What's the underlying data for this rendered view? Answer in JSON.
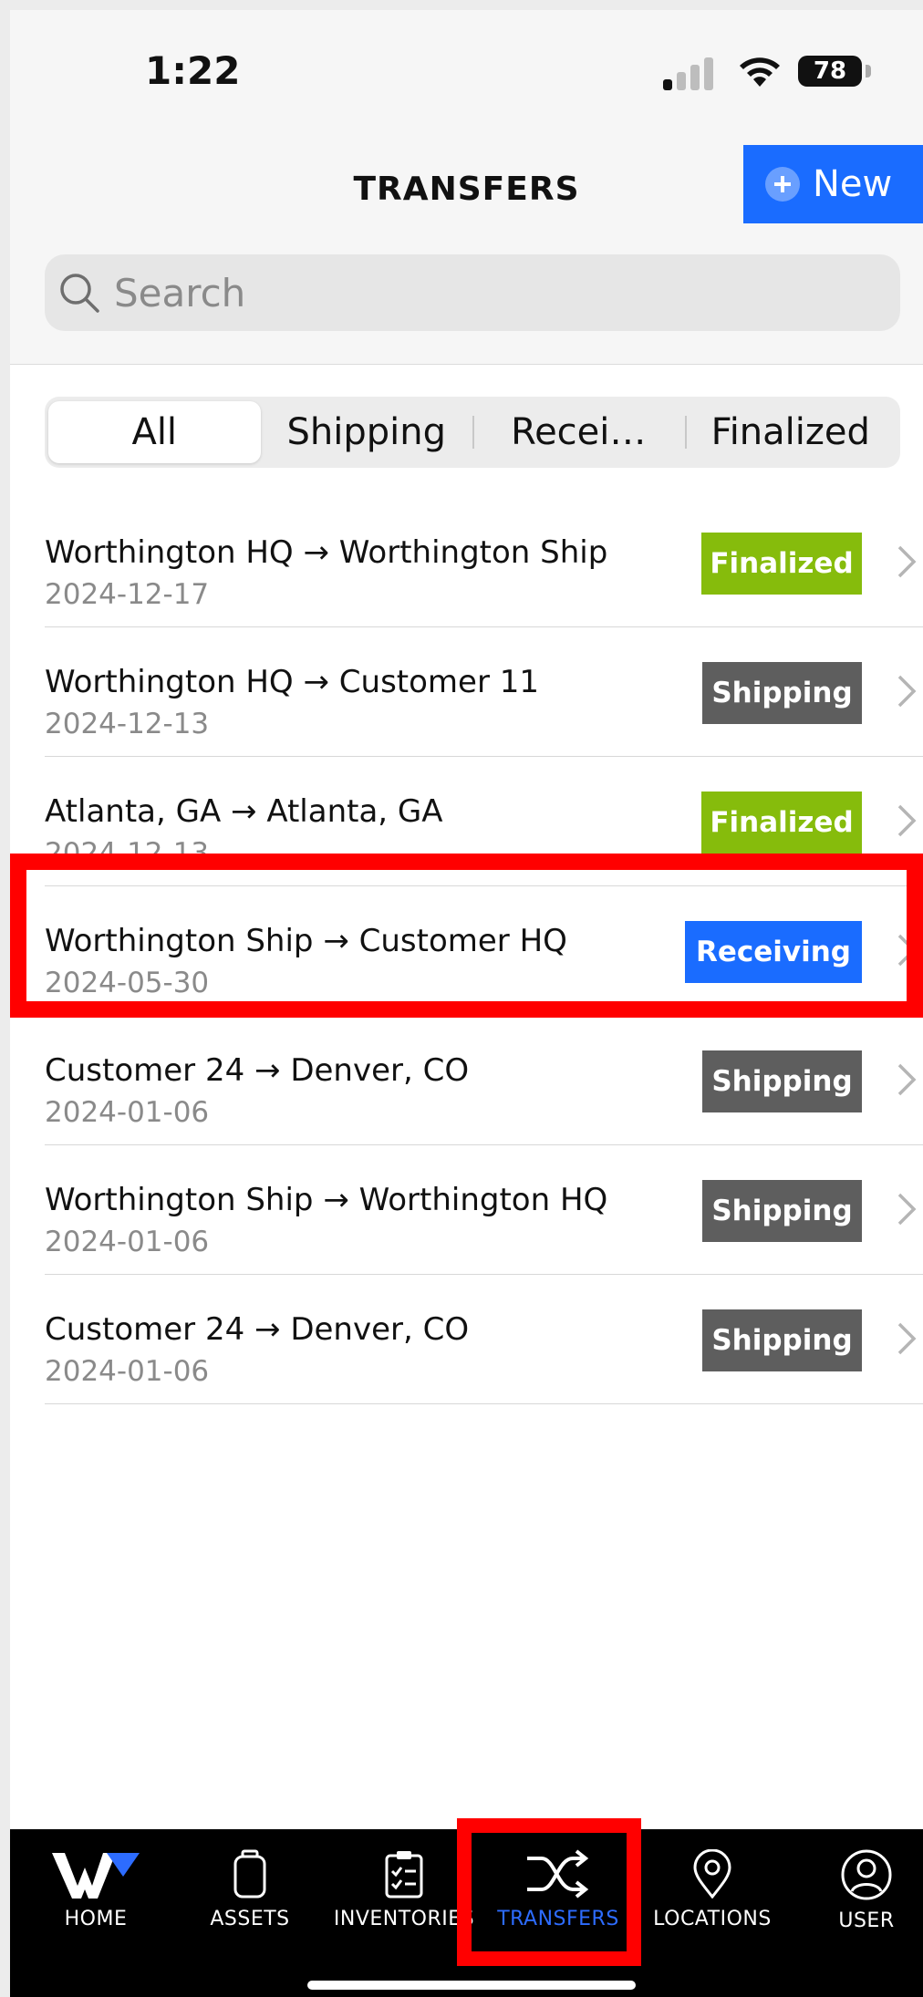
{
  "status_bar": {
    "time": "1:22",
    "battery": "78"
  },
  "header": {
    "title": "TRANSFERS",
    "new_label": "New"
  },
  "search": {
    "placeholder": "Search"
  },
  "filters": {
    "all": "All",
    "shipping": "Shipping",
    "receiving": "Recei…",
    "finalized": "Finalized"
  },
  "colors": {
    "accent": "#1a6cff",
    "finalized": "#86bc0c",
    "shipping": "#5e5e5e",
    "receiving": "#1a6cff",
    "highlight": "#ff0000"
  },
  "transfers": [
    {
      "route": "Worthington HQ → Worthington Ship",
      "date": "2024-12-17",
      "status": "Finalized"
    },
    {
      "route": "Worthington HQ → Customer 11",
      "date": "2024-12-13",
      "status": "Shipping"
    },
    {
      "route": "Atlanta, GA → Atlanta, GA",
      "date": "2024-12-13",
      "status": "Finalized"
    },
    {
      "route": "Worthington Ship → Customer HQ",
      "date": "2024-05-30",
      "status": "Receiving"
    },
    {
      "route": "Customer 24 → Denver, CO",
      "date": "2024-01-06",
      "status": "Shipping"
    },
    {
      "route": "Worthington Ship → Worthington HQ",
      "date": "2024-01-06",
      "status": "Shipping"
    },
    {
      "route": "Customer 24 → Denver, CO",
      "date": "2024-01-06",
      "status": "Shipping"
    }
  ],
  "tabs": {
    "home": "HOME",
    "assets": "ASSETS",
    "inventories": "INVENTORIES",
    "transfers": "TRANSFERS",
    "locations": "LOCATIONS",
    "user": "USER"
  }
}
